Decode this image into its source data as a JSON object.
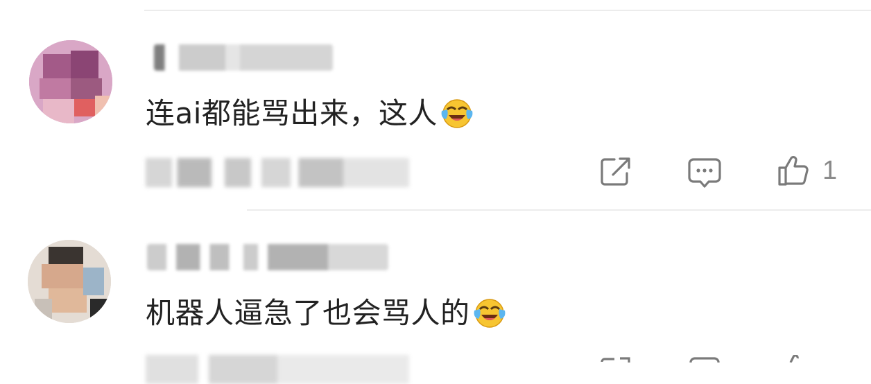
{
  "comments": [
    {
      "text": "连ai都能骂出来，这人",
      "emoji": "laughing-crying-emoji",
      "likes": "1"
    },
    {
      "text": "机器人逼急了也会骂人的",
      "emoji": "laughing-crying-emoji"
    }
  ],
  "actions": {
    "share_icon": "share-icon",
    "reply_icon": "comment-bubble-icon",
    "like_icon": "thumbs-up-icon"
  }
}
